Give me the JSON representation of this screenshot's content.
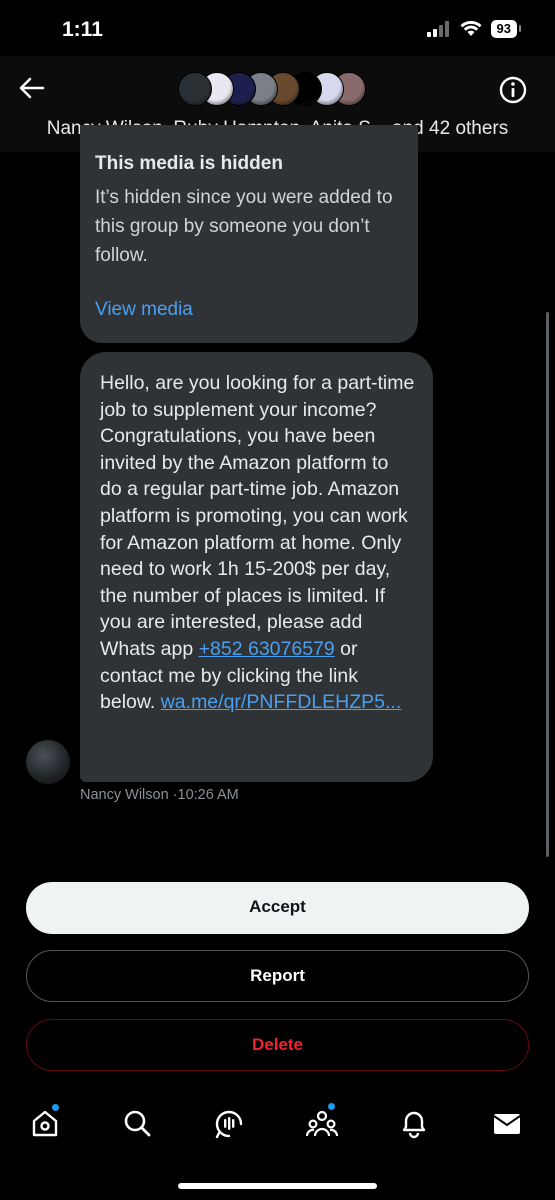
{
  "status": {
    "time": "1:11",
    "battery": "93"
  },
  "header": {
    "title": "Nancy Wilson, Ruby Hampton, Anita S... and 42 others",
    "avatar_colors": [
      "#2b3035",
      "#e8e8f0",
      "#1c1f4d",
      "#7a7f88",
      "#6a4a2e",
      "#000000",
      "#d8d8ee",
      "#8a6b6b"
    ]
  },
  "media": {
    "title": "This media is hidden",
    "description": "It’s hidden since you were added to this group by someone you don’t follow.",
    "link": "View media"
  },
  "message": {
    "text_main": "Hello, are you looking for a part-time job to supplement your income? Congratulations, you have been invited by the Amazon platform to do a regular part-time job. Amazon platform is promoting, you can work for Amazon platform at home. Only need to work 1h 15-200$ per day, the number of places is limited. If you are interested, please add Whats app ",
    "phone": "+852 63076579",
    "text_mid": " or contact me by clicking the link below. ",
    "url": "wa.me/qr/PNFFDLEHZP5...",
    "sender": "Nancy Wilson",
    "time": "10:26 AM"
  },
  "actions": {
    "accept": "Accept",
    "report": "Report",
    "delete": "Delete"
  },
  "tabs": [
    "home-icon",
    "search-icon",
    "spaces-icon",
    "communities-icon",
    "notifications-icon",
    "messages-icon"
  ],
  "colors": {
    "accent": "#1d9bf0",
    "danger": "#f4212e",
    "bubble": "#2f3336"
  }
}
